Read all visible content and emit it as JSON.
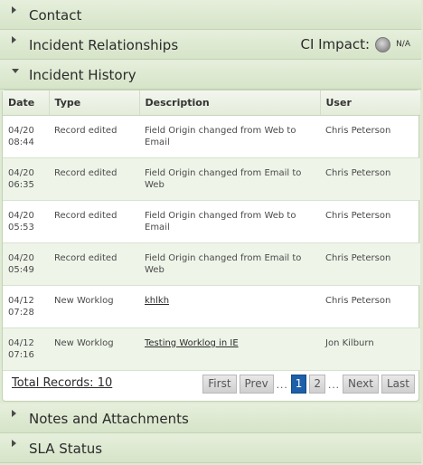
{
  "sections": {
    "contact": {
      "title": "Contact"
    },
    "relationships": {
      "title": "Incident Relationships"
    },
    "history": {
      "title": "Incident History"
    },
    "notes": {
      "title": "Notes and Attachments"
    },
    "sla": {
      "title": "SLA Status"
    }
  },
  "ci_impact": {
    "label": "CI Impact:",
    "value": "N/A"
  },
  "table": {
    "headers": {
      "date": "Date",
      "type": "Type",
      "description": "Description",
      "user": "User"
    },
    "rows": [
      {
        "date1": "04/20",
        "date2": "08:44",
        "type": "Record edited",
        "description": "Field Origin changed from Web to Email",
        "user": "Chris Peterson"
      },
      {
        "date1": "04/20",
        "date2": "06:35",
        "type": "Record edited",
        "description": "Field Origin changed from Email to Web",
        "user": "Chris Peterson"
      },
      {
        "date1": "04/20",
        "date2": "05:53",
        "type": "Record edited",
        "description": "Field Origin changed from Web to Email",
        "user": "Chris Peterson"
      },
      {
        "date1": "04/20",
        "date2": "05:49",
        "type": "Record edited",
        "description": "Field Origin changed from Email to Web",
        "user": "Chris Peterson"
      },
      {
        "date1": "04/12",
        "date2": "07:28",
        "type": "New Worklog",
        "description": "khlkh",
        "user": "Chris Peterson"
      },
      {
        "date1": "04/12",
        "date2": "07:16",
        "type": "New Worklog",
        "description": "Testing Worklog in IE",
        "user": "Jon Kilburn"
      }
    ]
  },
  "footer": {
    "total": "Total Records: 10",
    "pager": {
      "first": "First",
      "prev": "Prev",
      "dots": "...",
      "page1": "1",
      "page2": "2",
      "next": "Next",
      "last": "Last"
    }
  }
}
